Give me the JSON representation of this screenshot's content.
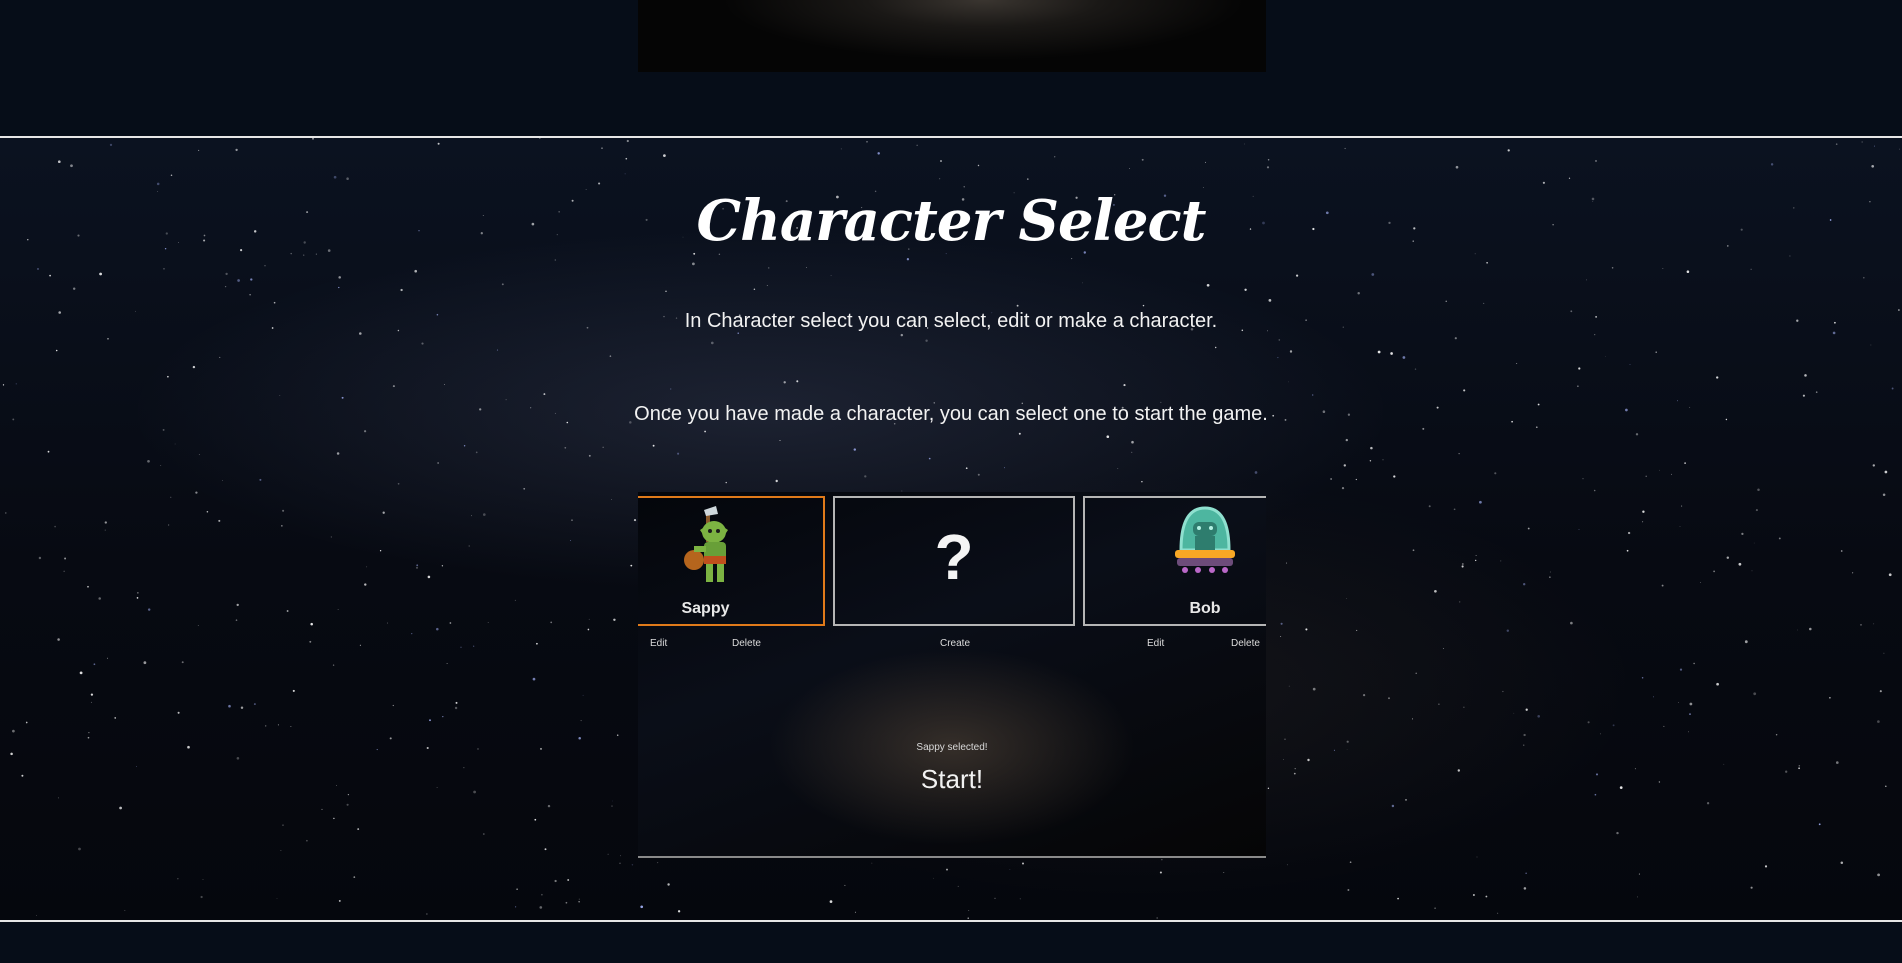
{
  "section": {
    "title": "Character Select",
    "paragraph_1": "In Character select you can select, edit or make a character.",
    "paragraph_2": "Once you have made a character, you can select one to start the game."
  },
  "screenshot": {
    "cards": [
      {
        "name": "Sappy",
        "selected": true,
        "icon": "goblin-icon",
        "edit_label": "Edit",
        "delete_label": "Delete"
      },
      {
        "name": "?",
        "selected": false,
        "icon": "question-mark-icon",
        "create_label": "Create"
      },
      {
        "name": "Bob",
        "selected": false,
        "icon": "alien-robot-icon",
        "edit_label": "Edit",
        "delete_label": "Delete"
      }
    ],
    "status": "Sappy selected!",
    "start_label": "Start!"
  },
  "colors": {
    "page_background": "#060d18",
    "selected_border": "#e07a1a",
    "card_border": "#b5b5b5",
    "divider": "#e6e6e6"
  }
}
